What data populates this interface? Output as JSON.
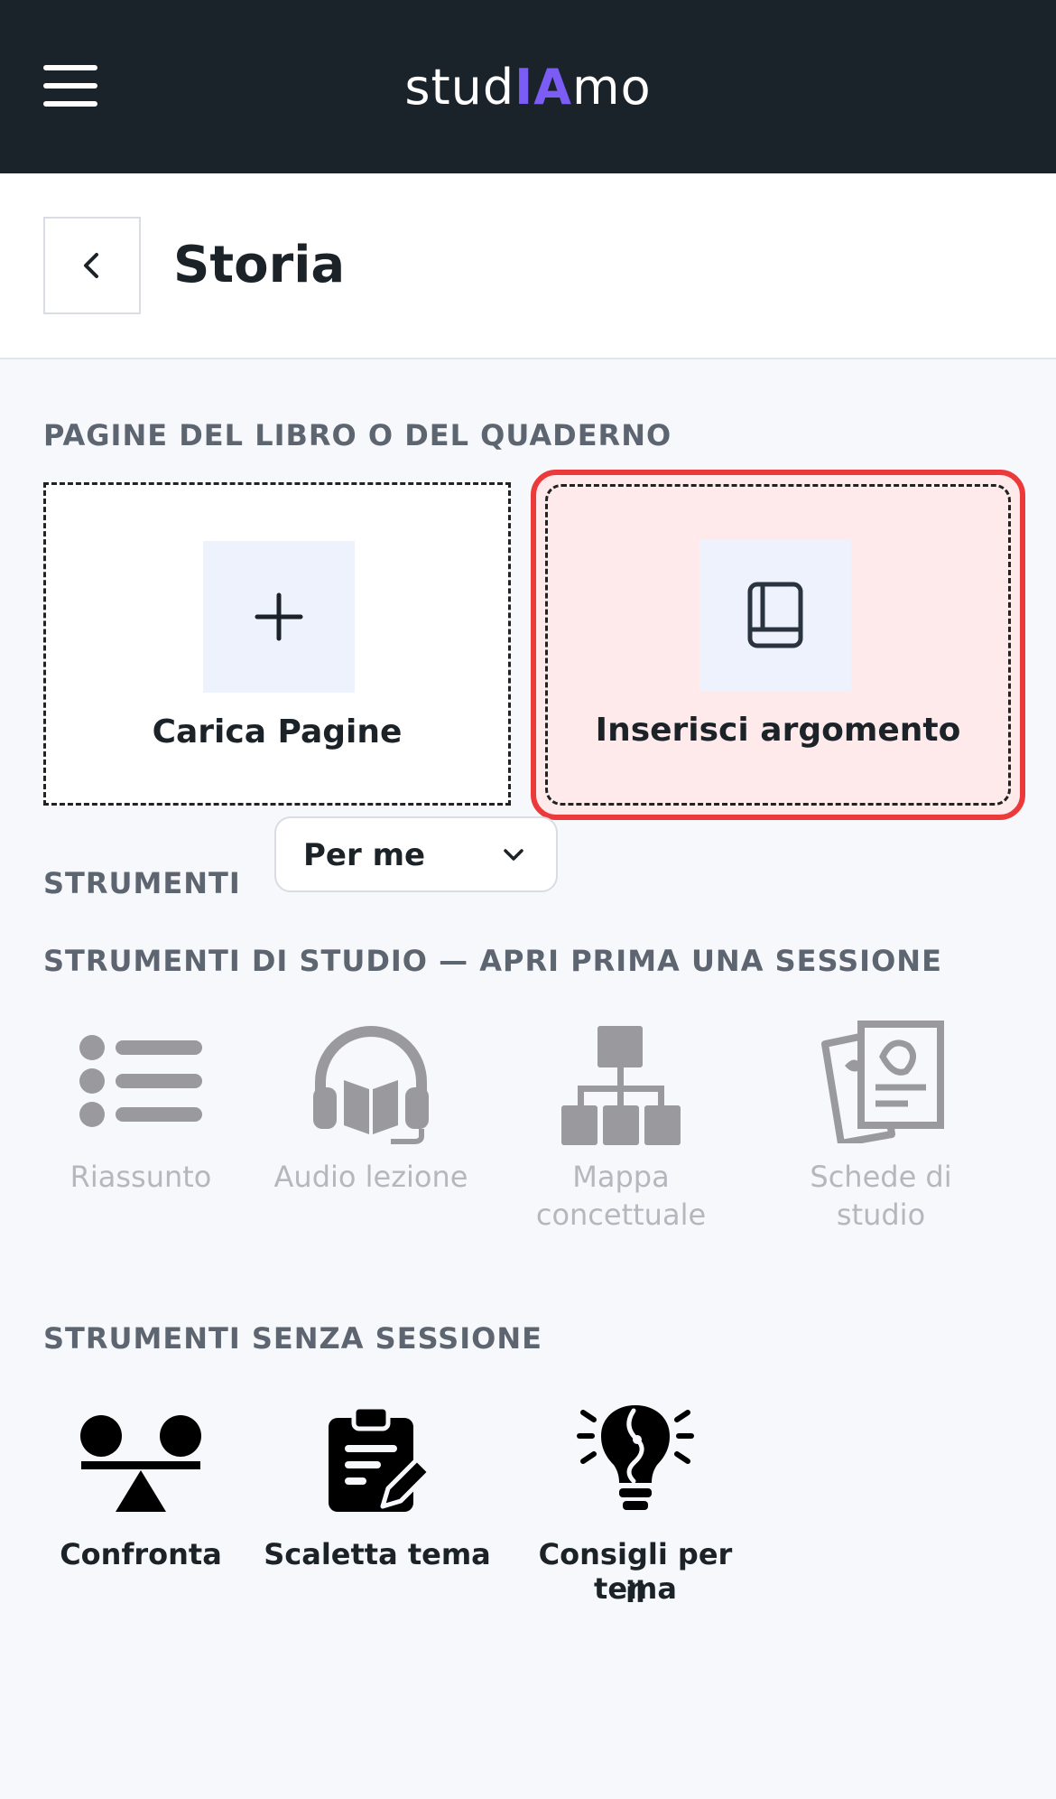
{
  "app": {
    "logo_prefix": "stud",
    "logo_highlight": "IA",
    "logo_suffix": "mo"
  },
  "header": {
    "title": "Storia"
  },
  "pages_section": {
    "label": "PAGINE DEL LIBRO O DEL QUADERNO",
    "upload_label": "Carica Pagine",
    "topic_label": "Inserisci argomento"
  },
  "tools_section": {
    "label": "STRUMENTI",
    "audience_selected": "Per me"
  },
  "study_tools": {
    "label": "STRUMENTI DI STUDIO — APRI PRIMA UNA SESSIONE",
    "items": [
      {
        "label": "Riassunto",
        "icon": "list-icon"
      },
      {
        "label": "Audio lezione",
        "icon": "headphones-book-icon"
      },
      {
        "label_line1": "Mappa",
        "label_line2": "concettuale",
        "icon": "sitemap-icon"
      },
      {
        "label_line1": "Schede di",
        "label_line2": "studio",
        "icon": "flashcards-icon"
      }
    ]
  },
  "free_tools": {
    "label": "STRUMENTI SENZA SESSIONE",
    "items": [
      {
        "label": "Confronta",
        "icon": "scale-compare-icon"
      },
      {
        "label": "Scaletta tema",
        "icon": "clipboard-pen-icon"
      },
      {
        "label_line1": "Consigli per il",
        "label_line2": "tema",
        "icon": "brain-bulb-icon"
      }
    ]
  },
  "colors": {
    "topbar": "#1b232a",
    "accent_ia": "#7b5cf5",
    "highlight_border": "#ec3a3a",
    "highlight_fill": "#feeaea",
    "disabled": "#9a9a9e"
  }
}
